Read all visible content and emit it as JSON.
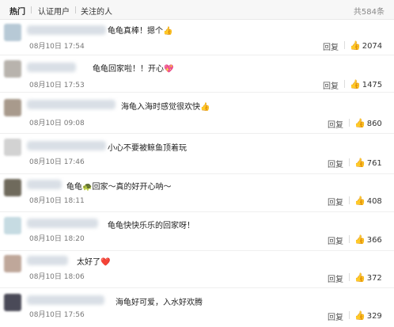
{
  "tabs": [
    {
      "label": "热门",
      "active": true
    },
    {
      "label": "认证用户",
      "active": false
    },
    {
      "label": "关注的人",
      "active": false
    }
  ],
  "total_count": "共584条",
  "reply_label": "回复",
  "comments": [
    {
      "text": "龟龟真棒！摁个👍",
      "time": "08月10日 17:54",
      "likes": "2074"
    },
    {
      "text": "龟龟回家啦！！开心💖",
      "time": "08月10日 17:53",
      "likes": "1475"
    },
    {
      "text": "海龟入海时感觉很欢快👍",
      "time": "08月10日 09:08",
      "likes": "860"
    },
    {
      "text": "小心不要被鲸鱼顶着玩",
      "time": "08月10日 17:46",
      "likes": "761"
    },
    {
      "text": "龟龟🐢回家～真的好开心呐～",
      "time": "08月10日 18:11",
      "likes": "408"
    },
    {
      "text": "龟龟快快乐乐的回家呀！",
      "time": "08月10日 18:20",
      "likes": "366"
    },
    {
      "text": "太好了❤️",
      "time": "08月10日 18:06",
      "likes": "372"
    },
    {
      "text": "海龟好可爱，入水好欢腾",
      "time": "08月10日 17:56",
      "likes": "329"
    }
  ],
  "colors": {
    "text": "#222222",
    "meta": "#777777",
    "heart": "#e0443a"
  },
  "icons": {
    "like": "thumbs-up-icon"
  }
}
